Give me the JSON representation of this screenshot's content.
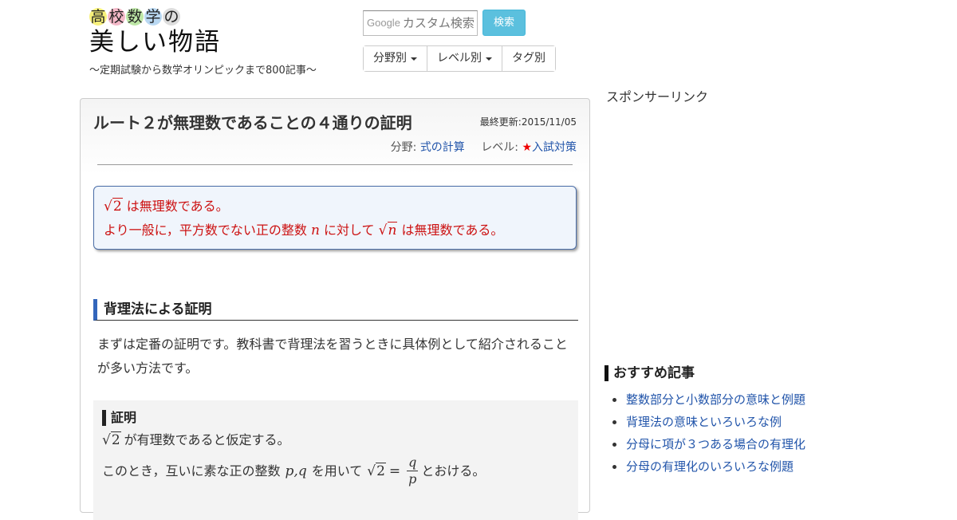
{
  "header": {
    "logo_chars": [
      {
        "char": "高",
        "color": "#f7f07a"
      },
      {
        "char": "校",
        "color": "#f4b8c8"
      },
      {
        "char": "数",
        "color": "#bde7a6"
      },
      {
        "char": "学",
        "color": "#b9d8f2"
      },
      {
        "char": "の",
        "color": "#dddddd"
      }
    ],
    "logo_main": "美しい物語",
    "logo_sub": "～定期試験から数学オリンピックまで800記事～",
    "search": {
      "logo": "Google",
      "placeholder": "カスタム検索",
      "button": "検索"
    },
    "filters": [
      {
        "label": "分野別",
        "dropdown": true
      },
      {
        "label": "レベル別",
        "dropdown": true
      },
      {
        "label": "タグ別",
        "dropdown": false
      }
    ]
  },
  "article": {
    "title": "ルート２が無理数であることの４通りの証明",
    "updated": "最終更新:2015/11/05",
    "field_label": "分野:",
    "field_value": "式の計算",
    "level_label": "レベル:",
    "level_star": "★",
    "level_value": "入試対策",
    "theorem": {
      "line1_num": "2",
      "line1_text": "は無理数である。",
      "line2_pre": "より一般に，平方数でない正の整数",
      "line2_var": "n",
      "line2_mid": "に対して",
      "line2_text": "は無理数である。"
    },
    "section_title": "背理法による証明",
    "intro": "まずは定番の証明です。教科書で背理法を習うときに具体例として紹介されることが多い方法です。",
    "proof": {
      "heading": "証明",
      "line1_num": "2",
      "line1_text": "が有理数であると仮定する。",
      "line2_pre": "このとき，互いに素な正の整数",
      "line2_vars": "p,q",
      "line2_mid": "を用いて",
      "line2_eq_num": "2",
      "line2_eq": "=",
      "frac_num": "q",
      "frac_den": "p",
      "line2_post": "とおける。"
    }
  },
  "sidebar": {
    "sponsor": "スポンサーリンク",
    "recommended_title": "おすすめ記事",
    "recommended": [
      "整数部分と小数部分の意味と例題",
      "背理法の意味といろいろな例",
      "分母に項が３つある場合の有理化",
      "分母の有理化のいろいろな例題"
    ]
  }
}
